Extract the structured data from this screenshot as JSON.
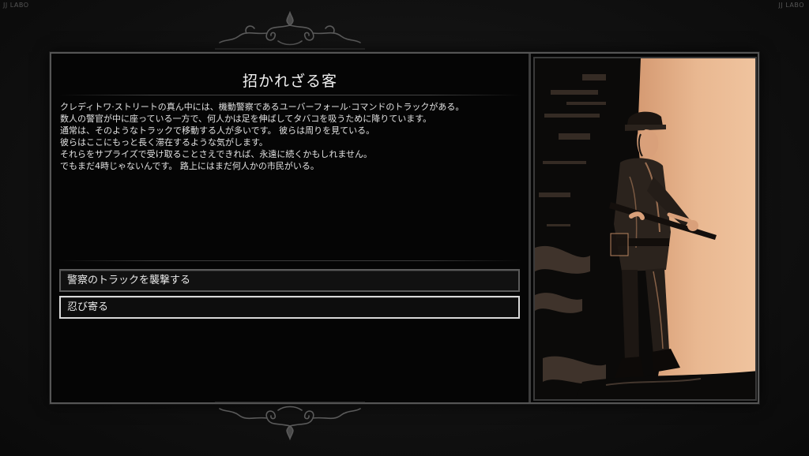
{
  "watermark": {
    "left": "JJ LABO",
    "right": "JJ LABO"
  },
  "event": {
    "title": "招かれざる客",
    "lines": [
      "クレディトワ·ストリートの真ん中には、機動警察であるユーバーフォール·コマンドのトラックがある。",
      "数人の警官が中に座っている一方で、何人かは足を伸ばしてタバコを吸うために降りています。",
      "通常は、そのようなトラックで移動する人が多いです。 彼らは周りを見ている。",
      "彼らはここにもっと長く滞在するような気がします。",
      "それらをサプライズで受け取ることさえできれば、永遠に続くかもしれません。",
      "でもまだ4時じゃないんです。 路上にはまだ何人かの市民がいる。"
    ]
  },
  "choices": [
    {
      "label": "警察のトラックを襲撃する",
      "selected": false
    },
    {
      "label": "忍び寄る",
      "selected": true
    }
  ],
  "illustration": {
    "subject": "soldier-with-rifle",
    "palette": {
      "dark": "#0b0a09",
      "light": "#e8b48d"
    }
  }
}
